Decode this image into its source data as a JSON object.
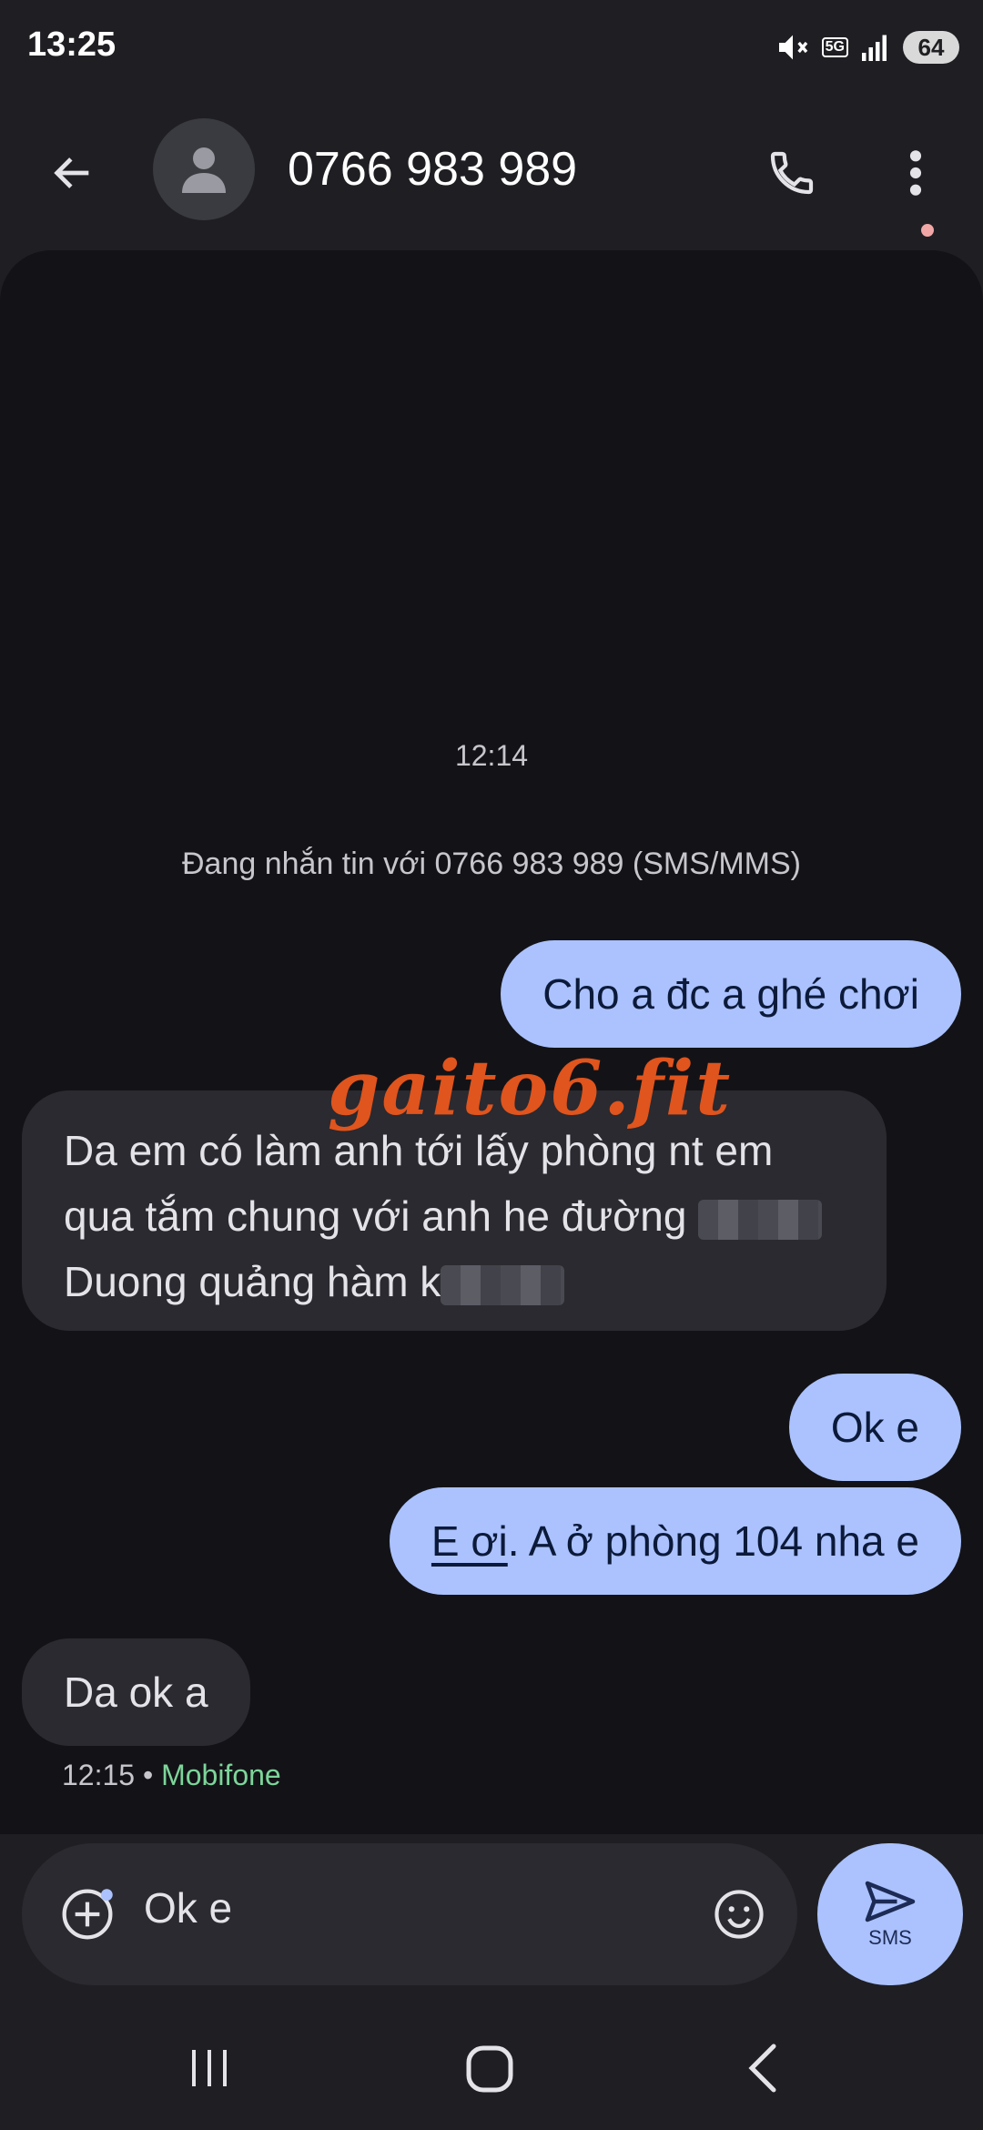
{
  "status_bar": {
    "time": "13:25",
    "network": "5G",
    "battery": "64"
  },
  "header": {
    "contact_name": "0766 983 989"
  },
  "conversation": {
    "time_header": "12:14",
    "info_line": "Đang nhắn tin với 0766 983 989 (SMS/MMS)",
    "messages": [
      {
        "direction": "outgoing",
        "text": "Cho a đc a ghé chơi"
      },
      {
        "direction": "incoming",
        "lines": [
          "Da em có làm anh tới lấy phòng nt em",
          "qua tắm chung với anh he đường",
          "Duong quảng hàm k"
        ]
      },
      {
        "direction": "outgoing",
        "text": "Ok e"
      },
      {
        "direction": "outgoing",
        "link_text": "E ơi",
        "text": ". A ở phòng 104 nha e"
      },
      {
        "direction": "incoming",
        "text": "Da ok a"
      }
    ],
    "last_meta": {
      "time": "12:15",
      "separator": "•",
      "carrier": "Mobifone"
    }
  },
  "watermark": "gaito6.fit",
  "composer": {
    "value": "Ok e",
    "send_label": "SMS"
  },
  "icons": [
    "back-arrow-icon",
    "person-icon",
    "phone-icon",
    "more-vert-icon",
    "add-circle-icon",
    "emoji-icon",
    "send-icon",
    "nav-recents-icon",
    "nav-home-icon",
    "nav-back-icon"
  ],
  "colors": {
    "outgoing_bubble": "#abc2ff",
    "incoming_bubble": "#2a2a30",
    "carrier": "#7dd59a",
    "watermark": "#e0541d"
  }
}
